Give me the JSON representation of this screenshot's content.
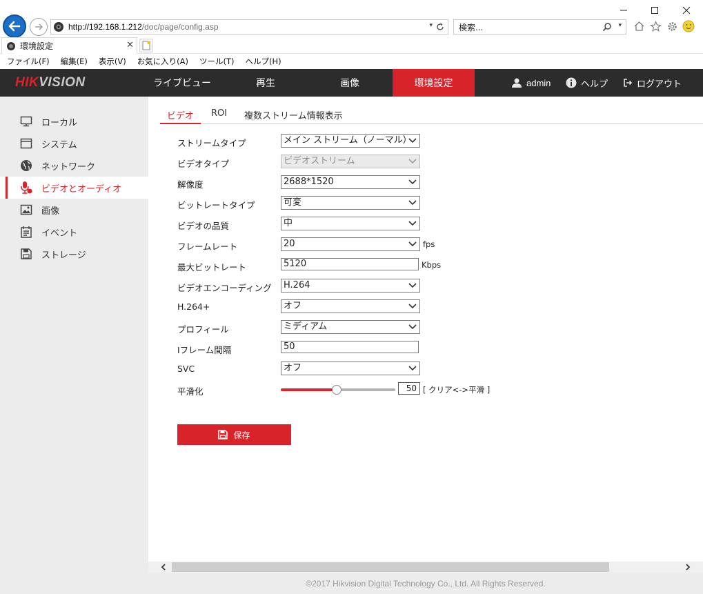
{
  "browser": {
    "url_host": "http://192.168.1.212",
    "url_path": "/doc/page/config.asp",
    "search_placeholder": "検索...",
    "tab_title": "環境設定",
    "menu": [
      "ファイル(F)",
      "編集(E)",
      "表示(V)",
      "お気に入り(A)",
      "ツール(T)",
      "ヘルプ(H)"
    ]
  },
  "header": {
    "logo_left": "HIK",
    "logo_right": "VISION",
    "nav": [
      "ライブビュー",
      "再生",
      "画像",
      "環境設定"
    ],
    "user": "admin",
    "help": "ヘルプ",
    "logout": "ログアウト",
    "accent_color": "#d8232a"
  },
  "sidebar": {
    "items": [
      {
        "label": "ローカル",
        "icon": "monitor-icon"
      },
      {
        "label": "システム",
        "icon": "window-icon"
      },
      {
        "label": "ネットワーク",
        "icon": "globe-icon"
      },
      {
        "label": "ビデオとオーディオ",
        "icon": "microphone-icon"
      },
      {
        "label": "画像",
        "icon": "image-icon"
      },
      {
        "label": "イベント",
        "icon": "calendar-icon"
      },
      {
        "label": "ストレージ",
        "icon": "floppy-icon"
      }
    ],
    "active_index": 3
  },
  "subtabs": [
    "ビデオ",
    "ROI",
    "複数ストリーム情報表示"
  ],
  "form": {
    "stream_type": {
      "label": "ストリームタイプ",
      "value": "メイン ストリーム（ノーマル）"
    },
    "video_type": {
      "label": "ビデオタイプ",
      "value": "ビデオストリーム"
    },
    "resolution": {
      "label": "解像度",
      "value": "2688*1520"
    },
    "bitrate_type": {
      "label": "ビットレートタイプ",
      "value": "可変"
    },
    "video_quality": {
      "label": "ビデオの品質",
      "value": "中"
    },
    "frame_rate": {
      "label": "フレームレート",
      "value": "20",
      "unit": "fps"
    },
    "max_bitrate": {
      "label": "最大ビットレート",
      "value": "5120",
      "unit": "Kbps"
    },
    "video_encoding": {
      "label": "ビデオエンコーディング",
      "value": "H.264"
    },
    "h264plus": {
      "label": "H.264+",
      "value": "オフ"
    },
    "profile": {
      "label": "プロフィール",
      "value": "ミディアム"
    },
    "i_frame_interval": {
      "label": "Iフレーム間隔",
      "value": "50"
    },
    "svc": {
      "label": "SVC",
      "value": "オフ"
    },
    "smoothing": {
      "label": "平滑化",
      "value": "50",
      "level_percent": 50,
      "hint": "[ クリア<->平滑 ]"
    }
  },
  "save_label": "保存",
  "footer": "©2017 Hikvision Digital Technology Co., Ltd. All Rights Reserved."
}
